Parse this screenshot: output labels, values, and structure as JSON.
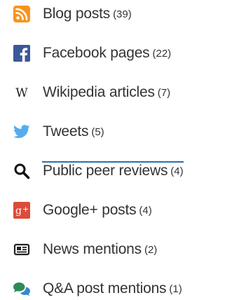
{
  "metrics": {
    "items": [
      {
        "icon": "rss-icon",
        "label": "Blog posts",
        "count": "(39)",
        "color": "#f7941d"
      },
      {
        "icon": "facebook-icon",
        "label": "Facebook pages",
        "count": "(22)",
        "color": "#3b5998"
      },
      {
        "icon": "wikipedia-icon",
        "label": "Wikipedia articles",
        "count": "(7)",
        "color": "#222222"
      },
      {
        "icon": "twitter-icon",
        "label": "Tweets",
        "count": "(5)",
        "color": "#55acee"
      },
      {
        "icon": "search-icon",
        "label": "Public peer reviews",
        "count": "(4)",
        "color": "#111111"
      },
      {
        "icon": "google-plus-icon",
        "label": "Google+ posts",
        "count": "(4)",
        "color": "#dd4b39"
      },
      {
        "icon": "newspaper-icon",
        "label": "News mentions",
        "count": "(2)",
        "color": "#222222"
      },
      {
        "icon": "chat-bubbles-icon",
        "label": "Q&A post mentions",
        "count": "(1)",
        "color": "#2e8b57"
      }
    ]
  }
}
